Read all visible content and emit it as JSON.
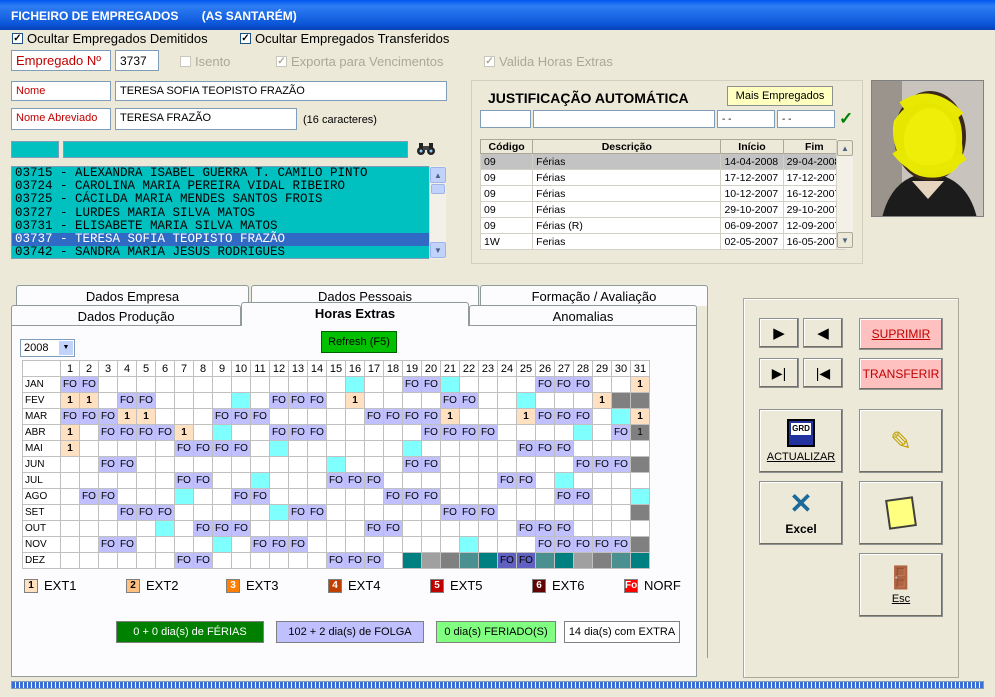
{
  "title": "FICHEIRO DE EMPREGADOS       (AS SANTARÉM)",
  "checks": {
    "hide_dismissed": "Ocultar Empregados Demitidos",
    "hide_transferred": "Ocultar Empregados Transferidos",
    "exempt": "Isento",
    "export_wages": "Exporta para Vencimentos",
    "validate_extra": "Valida Horas Extras"
  },
  "employee": {
    "number_label": "Empregado Nº",
    "number": "3737",
    "name_label": "Nome",
    "name": "TERESA SOFIA TEOPISTO FRAZÃO",
    "short_label": "Nome Abreviado",
    "short": "TERESA FRAZÃO",
    "chars": "(16 caracteres)"
  },
  "employee_list": [
    "03715 - ALEXANDRA ISABEL GUERRA T. CAMILO PINTO",
    "03724 - CAROLINA MARIA PEREIRA VIDAL RIBEIRO",
    "03725 - CÁCILDA MARIA MENDES SANTOS FROIS",
    "03727 - LURDES MARIA SILVA MATOS",
    "03731 - ELISABETE MARIA SILVA MATOS",
    "03737 - TERESA SOFIA TEOPISTO FRAZÃO",
    "03742 - SANDRA MARIA JESUS RODRIGUES"
  ],
  "justification": {
    "title": "JUSTIFICAÇÃO AUTOMÁTICA",
    "more_button": "Mais Empregados",
    "date_placeholder": "  -  -",
    "headers": [
      "Código",
      "Descrição",
      "Início",
      "Fim"
    ],
    "rows": [
      [
        "09",
        "Férias",
        "14-04-2008",
        "29-04-2008"
      ],
      [
        "09",
        "Férias",
        "17-12-2007",
        "17-12-2007"
      ],
      [
        "09",
        "Férias",
        "10-12-2007",
        "16-12-2007"
      ],
      [
        "09",
        "Férias",
        "29-10-2007",
        "29-10-2007"
      ],
      [
        "09",
        "Férias  (R)",
        "06-09-2007",
        "12-09-2007"
      ],
      [
        "1W",
        "Ferias",
        "02-05-2007",
        "16-05-2007"
      ]
    ]
  },
  "tabs": {
    "row1": [
      "Dados Empresa",
      "Dados Pessoais",
      "Formação / Avaliação"
    ],
    "row2": [
      "Dados Produção",
      "Horas Extras",
      "Anomalias"
    ]
  },
  "overtime": {
    "year": "2008",
    "refresh": "Refresh (F5)",
    "days": [
      "1",
      "2",
      "3",
      "4",
      "5",
      "6",
      "7",
      "8",
      "9",
      "10",
      "11",
      "12",
      "13",
      "14",
      "15",
      "16",
      "17",
      "18",
      "19",
      "20",
      "21",
      "22",
      "23",
      "24",
      "25",
      "26",
      "27",
      "28",
      "29",
      "30",
      "31"
    ],
    "months": [
      "JAN",
      "FEV",
      "MAR",
      "ABR",
      "MAI",
      "JUN",
      "JUL",
      "AGO",
      "SET",
      "OUT",
      "NOV",
      "DEZ"
    ],
    "legend": [
      "EXT1",
      "EXT2",
      "EXT3",
      "EXT4",
      "EXT5",
      "EXT6",
      "NORF"
    ],
    "legend_marks": [
      "1",
      "2",
      "3",
      "4",
      "5",
      "6",
      "Fo"
    ],
    "summary": {
      "vacation": "0 + 0 dia(s) de FÉRIAS",
      "dayoff": "102 + 2 dia(s) de FOLGA",
      "holiday": "0 dia(s) FERIADO(S)",
      "extra": "14 dia(s) com EXTRA"
    },
    "grid": [
      "Fo,Fo,,,,,,,,,,,,,,,,,Fo,Fo,,,,,,Fo,Fo,Fo,,,1",
      "1,1,,Fo,Fo,,,,,,,Fo,Fo,Fo,,1,,,,,Fo,Fo,,,,,,,1,,",
      "Fo,Fo,Fo,1,1,,,,Fo,Fo,Fo,,,,,,Fo,Fo,Fo,Fo,1,,,,1,Fo,Fo,Fo,,,1",
      "1,,Fo,Fo,Fo,Fo,1,,,,,Fo,Fo,Fo,,,,,,Fo,Fo,Fo,Fo,,,,,,,Fo,1",
      "1,,,,,,Fo,Fo,Fo,Fo,,,,,,,,,,,,,,,Fo,Fo,Fo,,,,",
      ",,Fo,Fo,,,,,,,,,,,,,,,Fo,Fo,,,,,,,,Fo,Fo,Fo,",
      ",,,,,,Fo,Fo,,,,,,,Fo,Fo,Fo,,,,,,,Fo,Fo,,,,,,",
      ",Fo,Fo,,,,,,,Fo,Fo,,,,,,,Fo,Fo,Fo,,,,,,,Fo,Fo,,,",
      ",,,Fo,Fo,Fo,,,,,,,Fo,Fo,,,,,,,Fo,Fo,Fo,,,,,,,,",
      ",,,,,,,Fo,Fo,Fo,,,,,,,Fo,Fo,,,,,,,Fo,Fo,Fo,,,,",
      ",,Fo,Fo,,,,,,,Fo,Fo,Fo,,,,,,,,,,,,,Fo,Fo,Fo,Fo,Fo,",
      ",,,,,,Fo,Fo,,,,,,,Fo,Fo,Fo,,,,,,,Fo,Fo,,,,,,"
    ]
  },
  "buttons": {
    "delete": "SUPRIMIR",
    "transfer": "TRANSFERIR",
    "update": "ACTUALIZAR",
    "excel": "Excel",
    "exit": "Esc",
    "update_icon_text": "GRD"
  },
  "colors": {
    "cyan": "#00c0c0",
    "dayoff": "#c0c0ff",
    "holiday": "#80ff80",
    "vacation": "#008000",
    "pink": "#ffc0c0"
  }
}
